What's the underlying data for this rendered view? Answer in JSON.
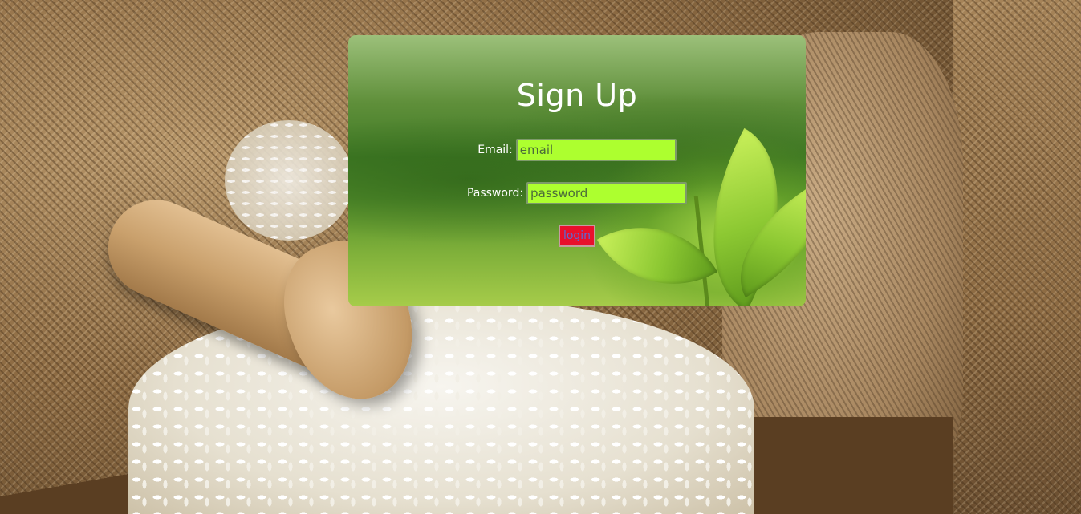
{
  "signup": {
    "title": "Sign Up",
    "email_label": "Email:",
    "email_placeholder": "email",
    "password_label": "Password:",
    "password_placeholder": "password",
    "login_label": "login"
  },
  "colors": {
    "input_background": "#adff2f",
    "button_background": "#e8102c",
    "button_text": "#5a6ad6",
    "title_text": "#ffffff"
  }
}
